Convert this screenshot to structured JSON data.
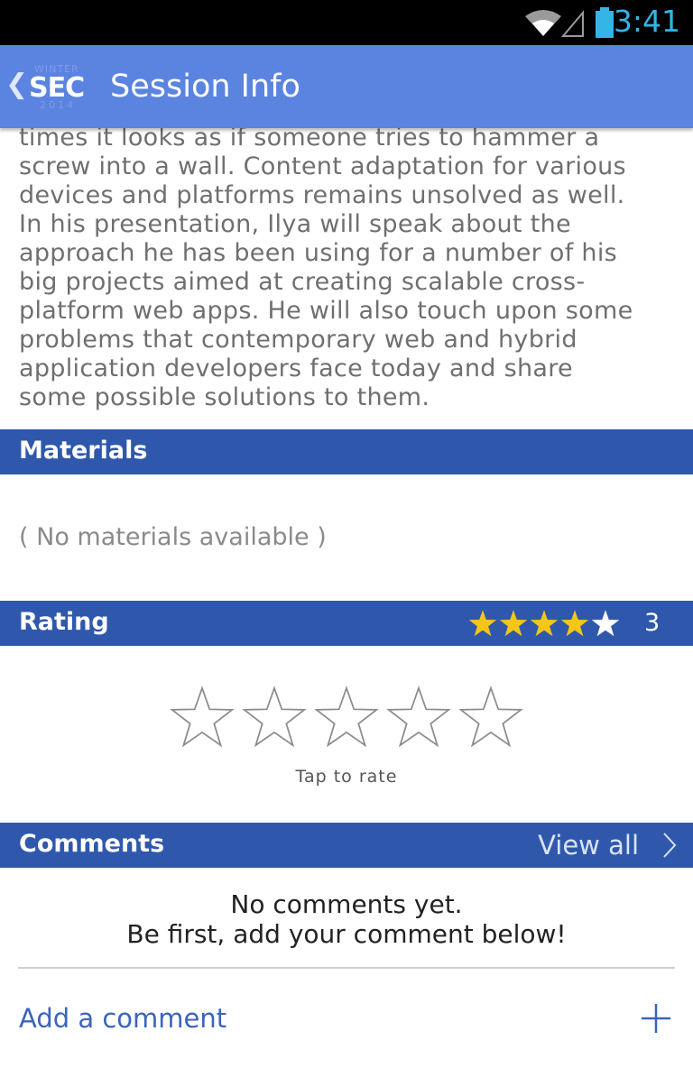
{
  "status_bar": {
    "time": "3:41",
    "wifi_icon": "wifi-icon",
    "signal_icon": "signal-icon",
    "battery_icon": "battery-icon"
  },
  "action_bar": {
    "back_icon": "chevron-left-icon",
    "logo": {
      "top": "WINTER",
      "main": "SEC",
      "bottom": "2014"
    },
    "title": "Session Info"
  },
  "description": {
    "lines": [
      "times it looks as if someone tries to hammer a",
      "screw into a wall. Content adaptation for various",
      "devices and platforms remains unsolved as well.",
      "In his presentation, Ilya will speak about the",
      "approach he has been using for a number of his",
      "big projects aimed at creating scalable cross-",
      "platform web apps. He will also touch upon some",
      "problems that contemporary web and hybrid",
      "application developers face today and share",
      "some possible solutions to them."
    ]
  },
  "materials": {
    "header": "Materials",
    "empty_text": "( No materials available )"
  },
  "rating": {
    "header": "Rating",
    "average_stars": 4,
    "max_stars": 5,
    "count": "3",
    "star_color_filled": "#f5c518",
    "star_color_empty": "#ffffff",
    "tap_to_rate": "Tap to rate"
  },
  "comments": {
    "header": "Comments",
    "view_all": "View all",
    "empty_line1": "No comments yet.",
    "empty_line2": "Be first, add your comment below!",
    "add_comment": "Add a comment",
    "add_icon": "plus-icon"
  },
  "colors": {
    "action_bar": "#5b83e0",
    "section_header": "#2f58ad",
    "accent_text": "#3a64bd",
    "clock": "#33b5e5"
  }
}
